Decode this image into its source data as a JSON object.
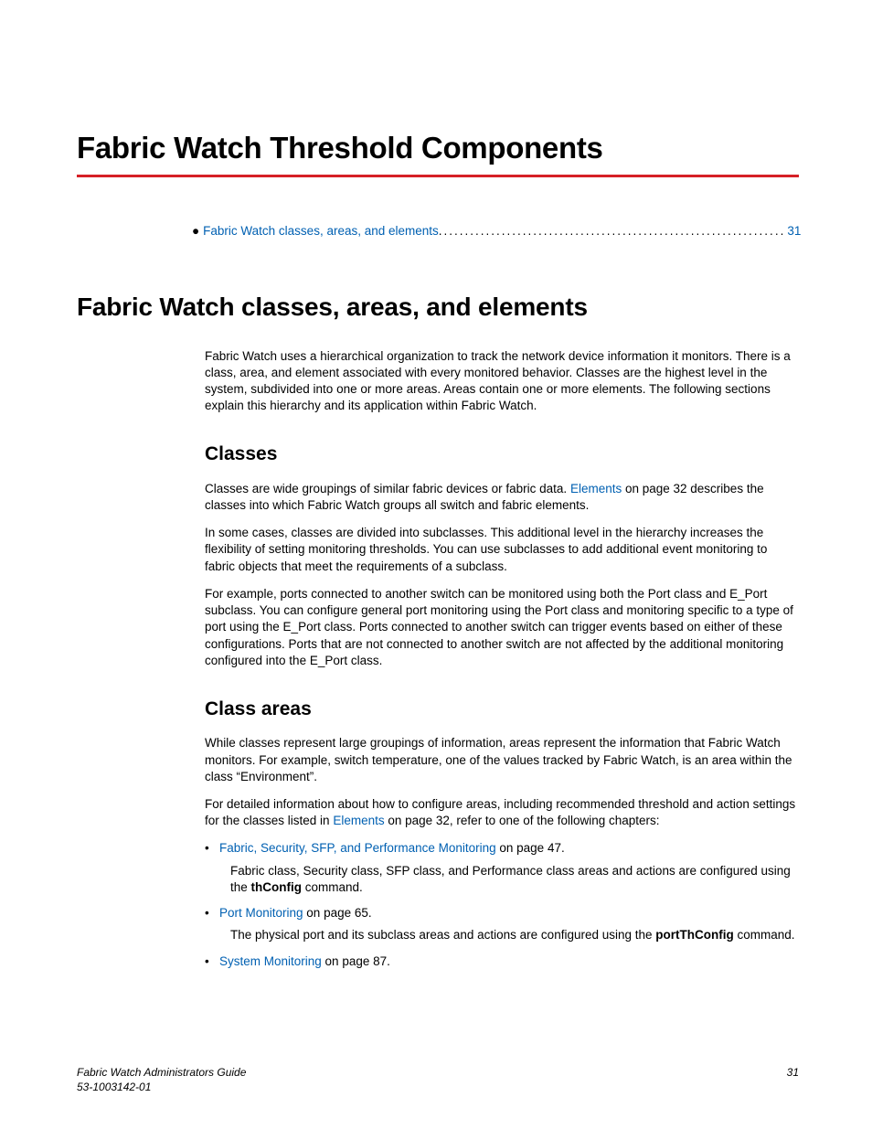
{
  "chapter_title": "Fabric Watch Threshold Components",
  "toc": {
    "entry_text": "Fabric Watch classes, areas, and elements",
    "page": "31"
  },
  "section_h2": "Fabric Watch classes, areas, and elements",
  "intro_para": "Fabric Watch uses a hierarchical organization to track the network device information it monitors. There is a class, area, and element associated with every monitored behavior. Classes are the highest level in the system, subdivided into one or more areas. Areas contain one or more elements. The following sections explain this hierarchy and its application within Fabric Watch.",
  "classes": {
    "heading": "Classes",
    "p1a": "Classes are wide groupings of similar fabric devices or fabric data. ",
    "p1_link": "Elements",
    "p1b": " on page 32 describes the classes into which Fabric Watch groups all switch and fabric elements.",
    "p2": "In some cases, classes are divided into subclasses. This additional level in the hierarchy increases the flexibility of setting monitoring thresholds. You can use subclasses to add additional event monitoring to fabric objects that meet the requirements of a subclass.",
    "p3": "For example, ports connected to another switch can be monitored using both the Port class and E_Port subclass. You can configure general port monitoring using the Port class and monitoring specific to a type of port using the E_Port class. Ports connected to another switch can trigger events based on either of these configurations. Ports that are not connected to another switch are not affected by the additional monitoring configured into the E_Port class."
  },
  "class_areas": {
    "heading": "Class areas",
    "p1": "While classes represent large groupings of information, areas represent the information that Fabric Watch monitors. For example, switch temperature, one of the values tracked by Fabric Watch, is an area within the class “Environment”.",
    "p2a": "For detailed information about how to configure areas, including recommended threshold and action settings for the classes listed in ",
    "p2_link": "Elements",
    "p2b": " on page 32, refer to one of the following chapters:",
    "b1_link": "Fabric, Security, SFP, and Performance Monitoring",
    "b1_tail": " on page 47.",
    "b1_body_a": "Fabric class, Security class, SFP class, and Performance class areas and actions are configured using the ",
    "b1_cmd": "thConfig",
    "b1_body_b": " command.",
    "b2_link": "Port Monitoring",
    "b2_tail": " on page 65.",
    "b2_body_a": "The physical port and its subclass areas and actions are configured using the ",
    "b2_cmd": "portThConfig",
    "b2_body_b": " command.",
    "b3_link": "System Monitoring",
    "b3_tail": " on page 87."
  },
  "footer": {
    "title": "Fabric Watch Administrators Guide",
    "docnum": "53-1003142-01",
    "page": "31"
  }
}
